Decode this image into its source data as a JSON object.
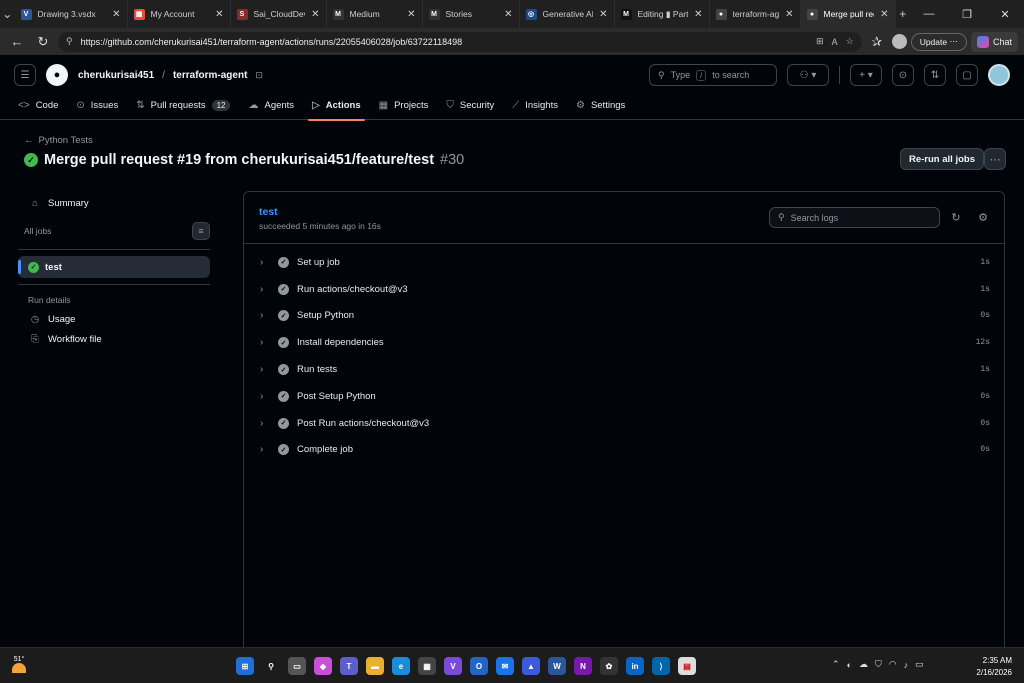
{
  "browser": {
    "tabs": [
      {
        "title": "Drawing 3.vsdx",
        "fav": "V",
        "color": "#2b579a"
      },
      {
        "title": "My Account",
        "fav": "▦",
        "color": "#e74c3c"
      },
      {
        "title": "Sai_CloudDevSe",
        "fav": "S",
        "color": "#8a2a2a"
      },
      {
        "title": "Medium",
        "fav": "M",
        "color": "#333333"
      },
      {
        "title": "Stories",
        "fav": "M",
        "color": "#333333"
      },
      {
        "title": "Generative AI (C",
        "fav": "◎",
        "color": "#1f4a8a"
      },
      {
        "title": "Editing ▮ Part",
        "fav": "M",
        "color": "#111111"
      },
      {
        "title": "terraform-agent",
        "fav": "●",
        "color": "#444444"
      },
      {
        "title": "Merge pull requ",
        "fav": "●",
        "color": "#444444"
      }
    ],
    "url": "https://github.com/cherukurisai451/terraform-agent/actions/runs/22055406028/job/63722118498",
    "update_label": "Update",
    "chat_label": "Chat"
  },
  "github": {
    "owner": "cherukurisai451",
    "repo": "terraform-agent",
    "search_prefix": "Type",
    "search_key": "/",
    "search_suffix": "to search",
    "nav": [
      {
        "label": "Code",
        "icon": "<>"
      },
      {
        "label": "Issues",
        "icon": "⊙"
      },
      {
        "label": "Pull requests",
        "icon": "⇅",
        "count": "12"
      },
      {
        "label": "Agents",
        "icon": "☁"
      },
      {
        "label": "Actions",
        "icon": "▷"
      },
      {
        "label": "Projects",
        "icon": "▦"
      },
      {
        "label": "Security",
        "icon": "⛉"
      },
      {
        "label": "Insights",
        "icon": "⟋"
      },
      {
        "label": "Settings",
        "icon": "⚙"
      }
    ]
  },
  "run": {
    "workflow": "Python Tests",
    "title": "Merge pull request #19 from cherukurisai451/feature/test",
    "number": "#30",
    "rerun_label": "Re-run all jobs"
  },
  "sidebar": {
    "summary": "Summary",
    "all_jobs": "All jobs",
    "job": "test",
    "run_details": "Run details",
    "usage": "Usage",
    "workflow_file": "Workflow file"
  },
  "job": {
    "name": "test",
    "meta": "succeeded 5 minutes ago in 16s",
    "search_placeholder": "Search logs",
    "steps": [
      {
        "name": "Set up job",
        "dur": "1s"
      },
      {
        "name": "Run actions/checkout@v3",
        "dur": "1s"
      },
      {
        "name": "Setup Python",
        "dur": "0s"
      },
      {
        "name": "Install dependencies",
        "dur": "12s"
      },
      {
        "name": "Run tests",
        "dur": "1s"
      },
      {
        "name": "Post Setup Python",
        "dur": "0s"
      },
      {
        "name": "Post Run actions/checkout@v3",
        "dur": "0s"
      },
      {
        "name": "Complete job",
        "dur": "0s"
      }
    ]
  },
  "taskbar": {
    "temp": "51°",
    "time": "2:35 AM",
    "date": "2/16/2026"
  }
}
